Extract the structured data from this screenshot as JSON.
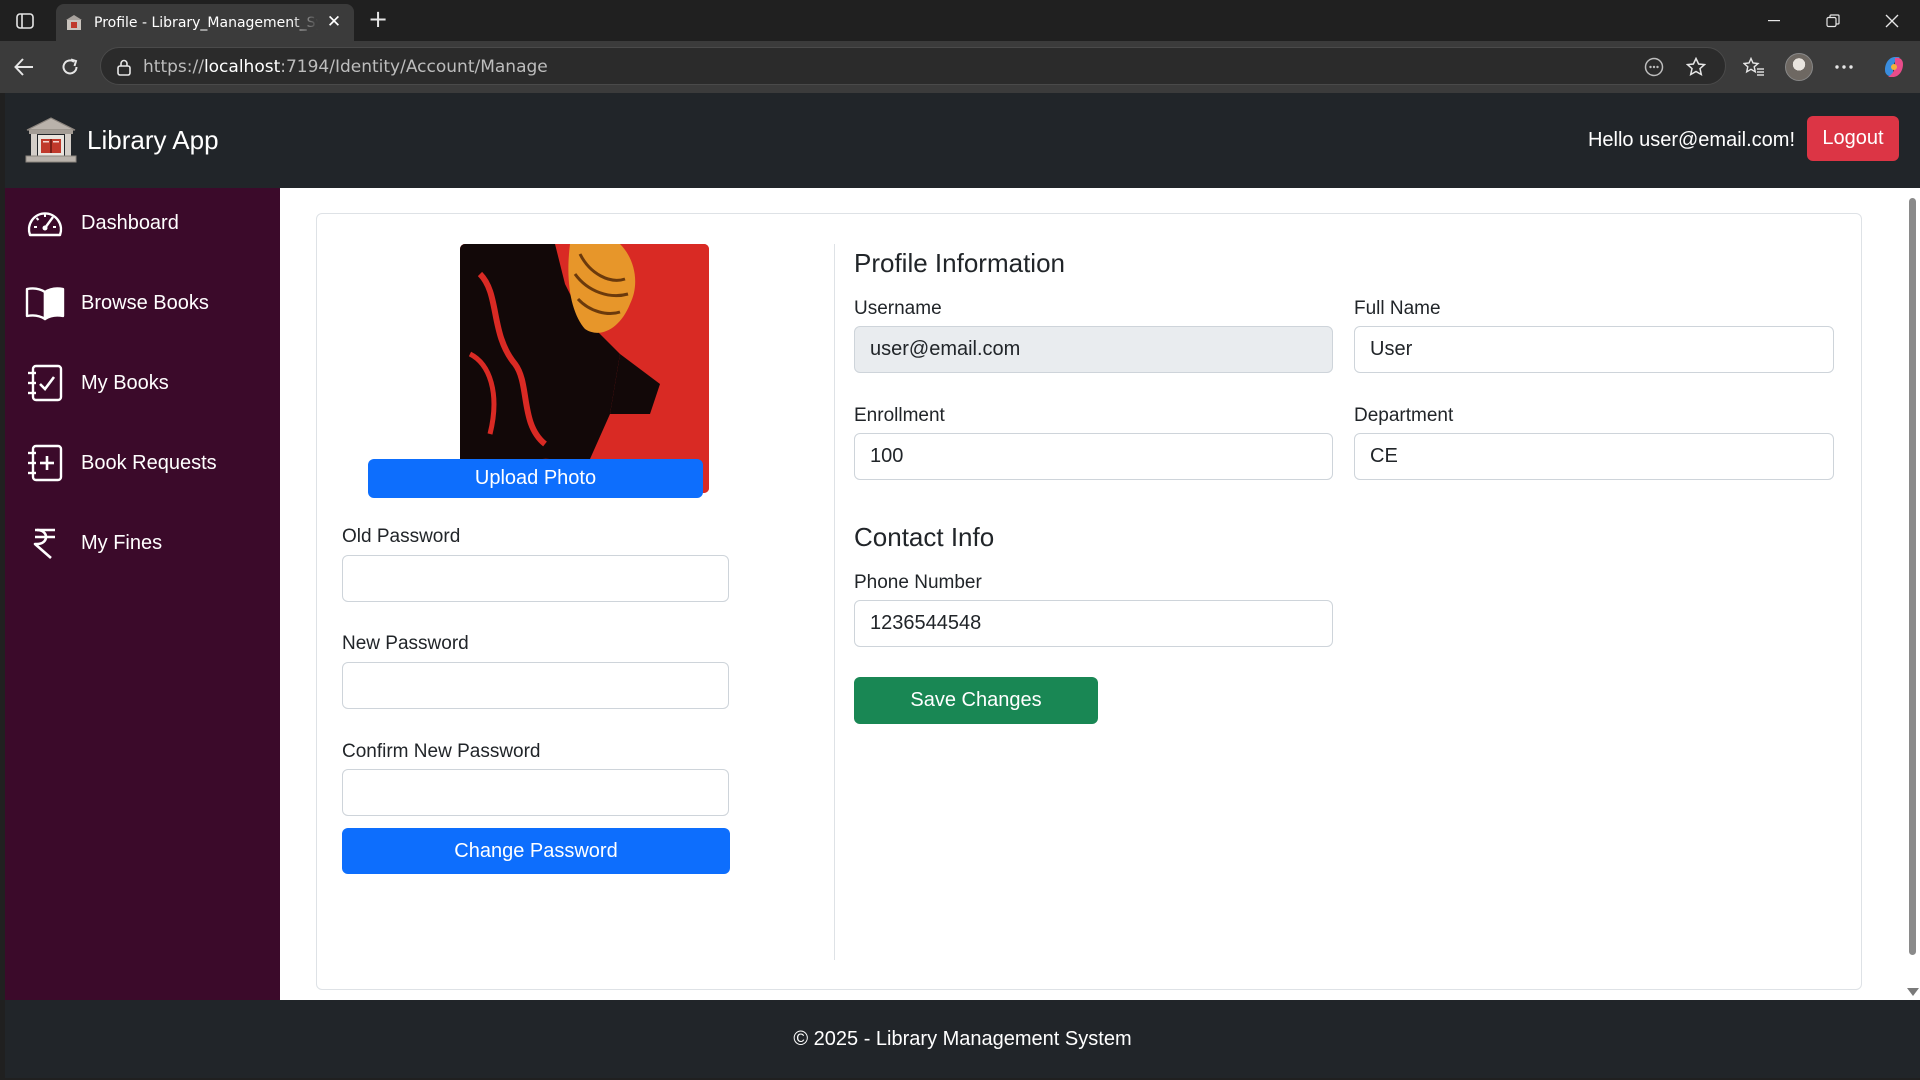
{
  "browser": {
    "tab_title": "Profile - Library_Management_System",
    "url_prefix": "https://",
    "url_host": "localhost",
    "url_rest": ":7194/Identity/Account/Manage"
  },
  "navbar": {
    "brand": "Library App",
    "greeting": "Hello user@email.com!",
    "logout_label": "Logout"
  },
  "sidebar": {
    "items": [
      {
        "label": "Dashboard",
        "icon": "speedometer-icon"
      },
      {
        "label": "Browse Books",
        "icon": "open-book-icon"
      },
      {
        "label": "My Books",
        "icon": "checklist-icon"
      },
      {
        "label": "Book Requests",
        "icon": "plus-list-icon"
      },
      {
        "label": "My Fines",
        "icon": "rupee-icon"
      }
    ]
  },
  "profile_left": {
    "upload_label": "Upload Photo",
    "old_password_label": "Old Password",
    "old_password_value": "",
    "new_password_label": "New Password",
    "new_password_value": "",
    "confirm_password_label": "Confirm New Password",
    "confirm_password_value": "",
    "change_password_label": "Change Password"
  },
  "profile_info": {
    "heading": "Profile Information",
    "username_label": "Username",
    "username_value": "user@email.com",
    "fullname_label": "Full Name",
    "fullname_value": "User",
    "enrollment_label": "Enrollment",
    "enrollment_value": "100",
    "department_label": "Department",
    "department_value": "CE"
  },
  "contact_info": {
    "heading": "Contact Info",
    "phone_label": "Phone Number",
    "phone_value": "1236544548",
    "save_label": "Save Changes"
  },
  "footer": {
    "text": "© 2025 - Library Management System"
  },
  "colors": {
    "navbar": "#212529",
    "sidebar": "#3b0a2a",
    "primary": "#0d6efd",
    "danger": "#dc3545",
    "success": "#198754"
  }
}
